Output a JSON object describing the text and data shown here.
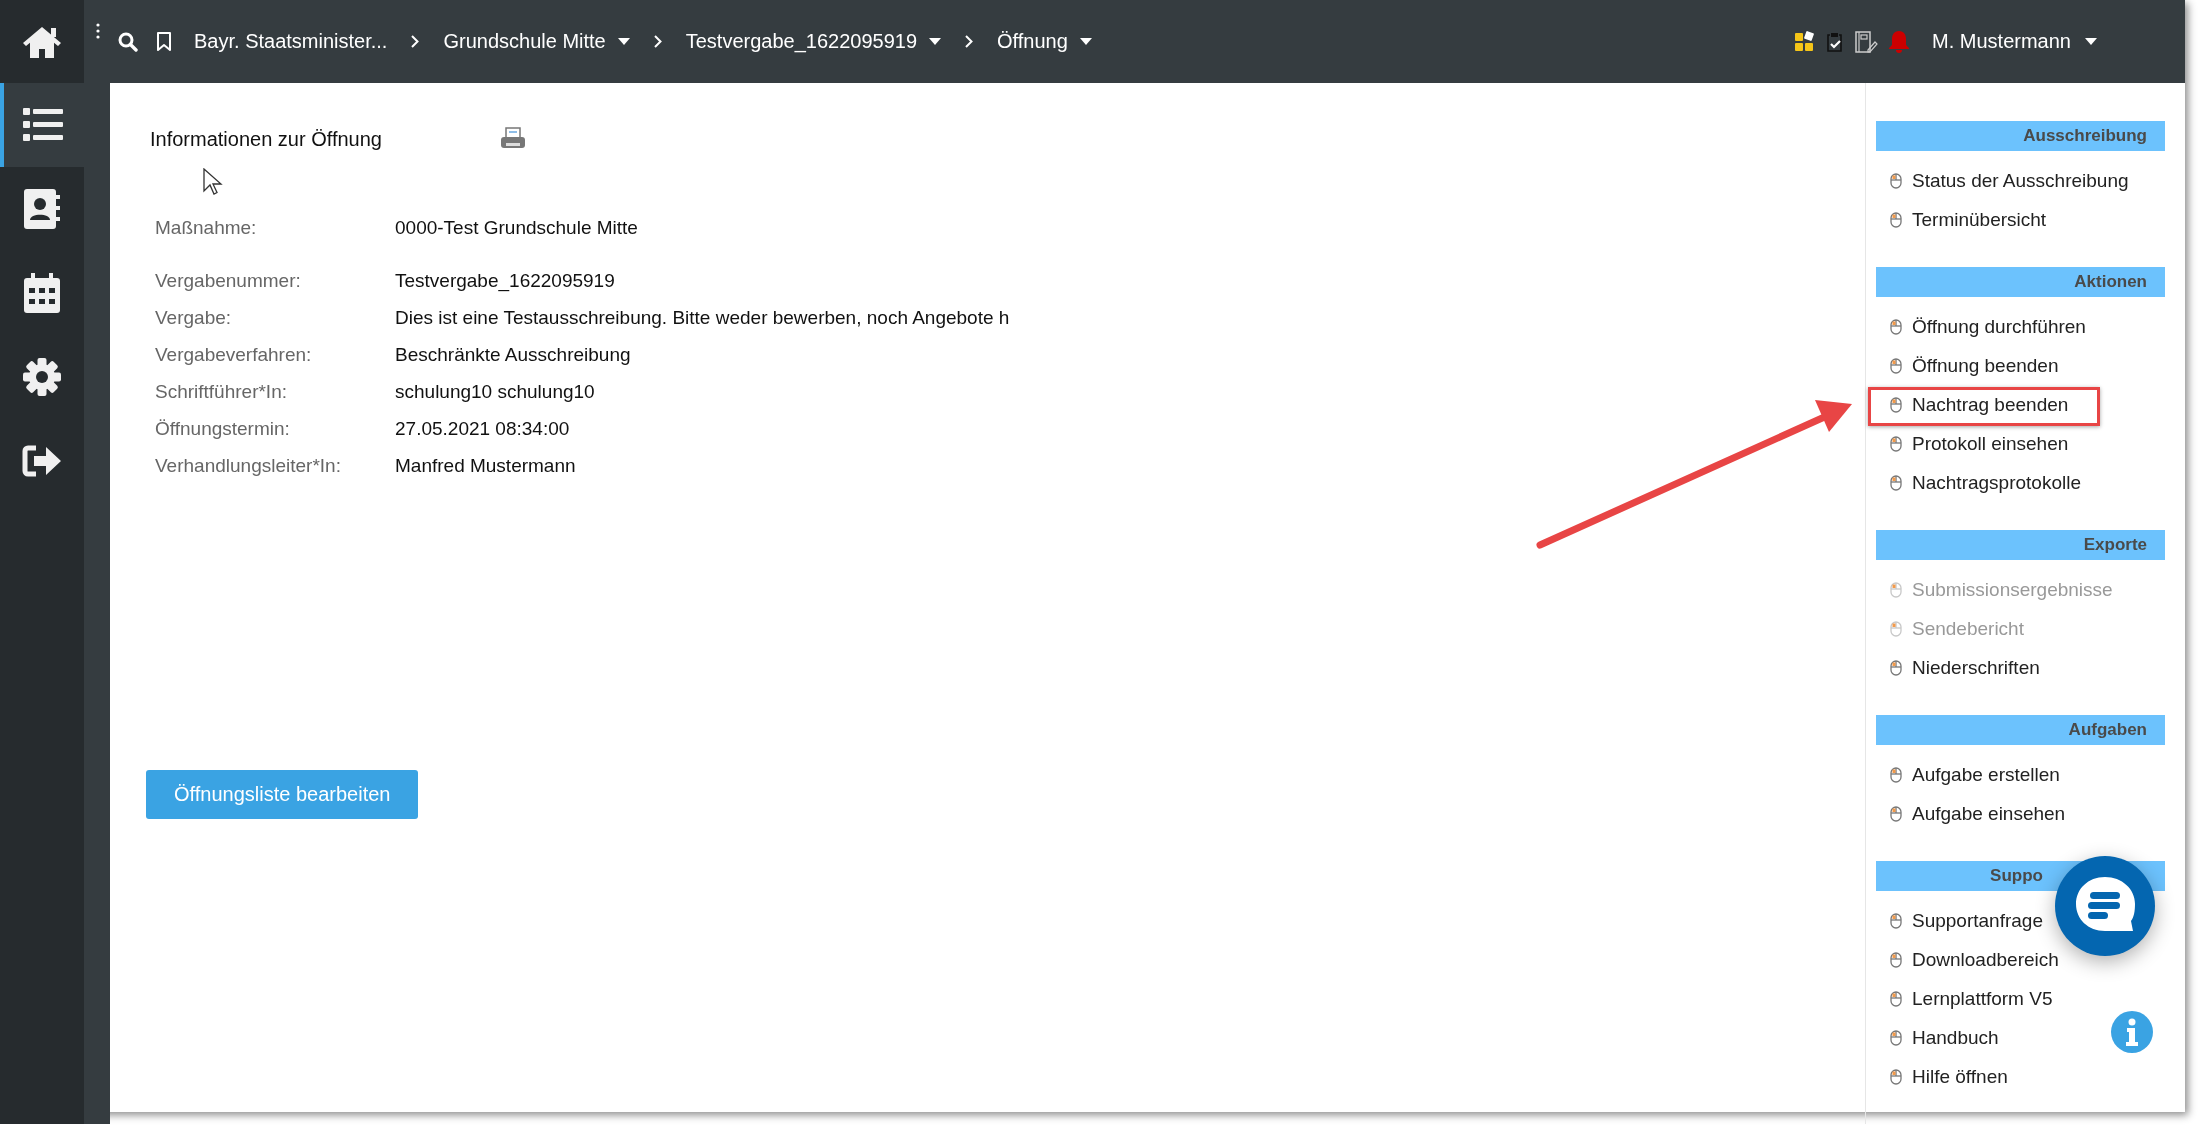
{
  "topbar": {
    "breadcrumbs": [
      {
        "label": "Bayr. Staatsminister...",
        "dropdown": false
      },
      {
        "label": "Grundschule Mitte",
        "dropdown": true
      },
      {
        "label": "Testvergabe_1622095919",
        "dropdown": true
      },
      {
        "label": "Öffnung",
        "dropdown": true
      }
    ],
    "user": {
      "name": "M. Mustermann",
      "dropdown": true
    }
  },
  "sidebar": {
    "items": [
      {
        "kind": "list",
        "selected": true
      },
      {
        "kind": "contacts",
        "selected": false
      },
      {
        "kind": "calendar",
        "selected": false
      },
      {
        "kind": "settings",
        "selected": false
      },
      {
        "kind": "logout",
        "selected": false
      }
    ]
  },
  "content": {
    "title": "Informationen zur Öffnung",
    "info_groups": [
      [
        {
          "label": "Maßnahme:",
          "value": "0000-Test Grundschule Mitte"
        }
      ],
      [
        {
          "label": "Vergabenummer:",
          "value": "Testvergabe_1622095919"
        },
        {
          "label": "Vergabe:",
          "value": "Dies ist eine Testausschreibung. Bitte weder bewerben, noch Angebote h"
        },
        {
          "label": "Vergabeverfahren:",
          "value": "Beschränkte Ausschreibung"
        },
        {
          "label": "Schriftführer*In:",
          "value": "schulung10 schulung10"
        },
        {
          "label": "Öffnungstermin:",
          "value": "27.05.2021 08:34:00"
        },
        {
          "label": "Verhandlungsleiter*In:",
          "value": "Manfred Mustermann"
        }
      ]
    ],
    "button": "Öffnungsliste bearbeiten"
  },
  "panels": [
    {
      "title_parts": [
        "Ausschreibung"
      ],
      "items": [
        {
          "label": "Status der Ausschreibung",
          "disabled": false,
          "highlighted": false
        },
        {
          "label": "Terminübersicht",
          "disabled": false,
          "highlighted": false
        }
      ]
    },
    {
      "title_parts": [
        "Aktionen"
      ],
      "items": [
        {
          "label": "Öffnung durchführen",
          "disabled": false,
          "highlighted": false
        },
        {
          "label": "Öffnung beenden",
          "disabled": false,
          "highlighted": false
        },
        {
          "label": "Nachtrag beenden",
          "disabled": false,
          "highlighted": true
        },
        {
          "label": "Protokoll einsehen",
          "disabled": false,
          "highlighted": false
        },
        {
          "label": "Nachtragsprotokolle",
          "disabled": false,
          "highlighted": false
        }
      ]
    },
    {
      "title_parts": [
        "Exporte"
      ],
      "items": [
        {
          "label": "Submissionsergebnisse",
          "disabled": true,
          "highlighted": false
        },
        {
          "label": "Sendebericht",
          "disabled": true,
          "highlighted": false
        },
        {
          "label": "Niederschriften",
          "disabled": false,
          "highlighted": false
        }
      ]
    },
    {
      "title_parts": [
        "Aufgaben"
      ],
      "items": [
        {
          "label": "Aufgabe erstellen",
          "disabled": false,
          "highlighted": false
        },
        {
          "label": "Aufgabe einsehen",
          "disabled": false,
          "highlighted": false
        }
      ]
    },
    {
      "title_parts": [
        "Suppo"
      ],
      "title_covered": true,
      "items": [
        {
          "label": "Supportanfrage",
          "disabled": false,
          "highlighted": false
        },
        {
          "label": "Downloadbereich",
          "disabled": false,
          "highlighted": false
        },
        {
          "label": "Lernplattform V5",
          "disabled": false,
          "highlighted": false
        },
        {
          "label": "Handbuch",
          "disabled": false,
          "highlighted": false
        },
        {
          "label": "Hilfe öffnen",
          "disabled": false,
          "highlighted": false
        }
      ]
    }
  ],
  "annotation_arrow": true
}
